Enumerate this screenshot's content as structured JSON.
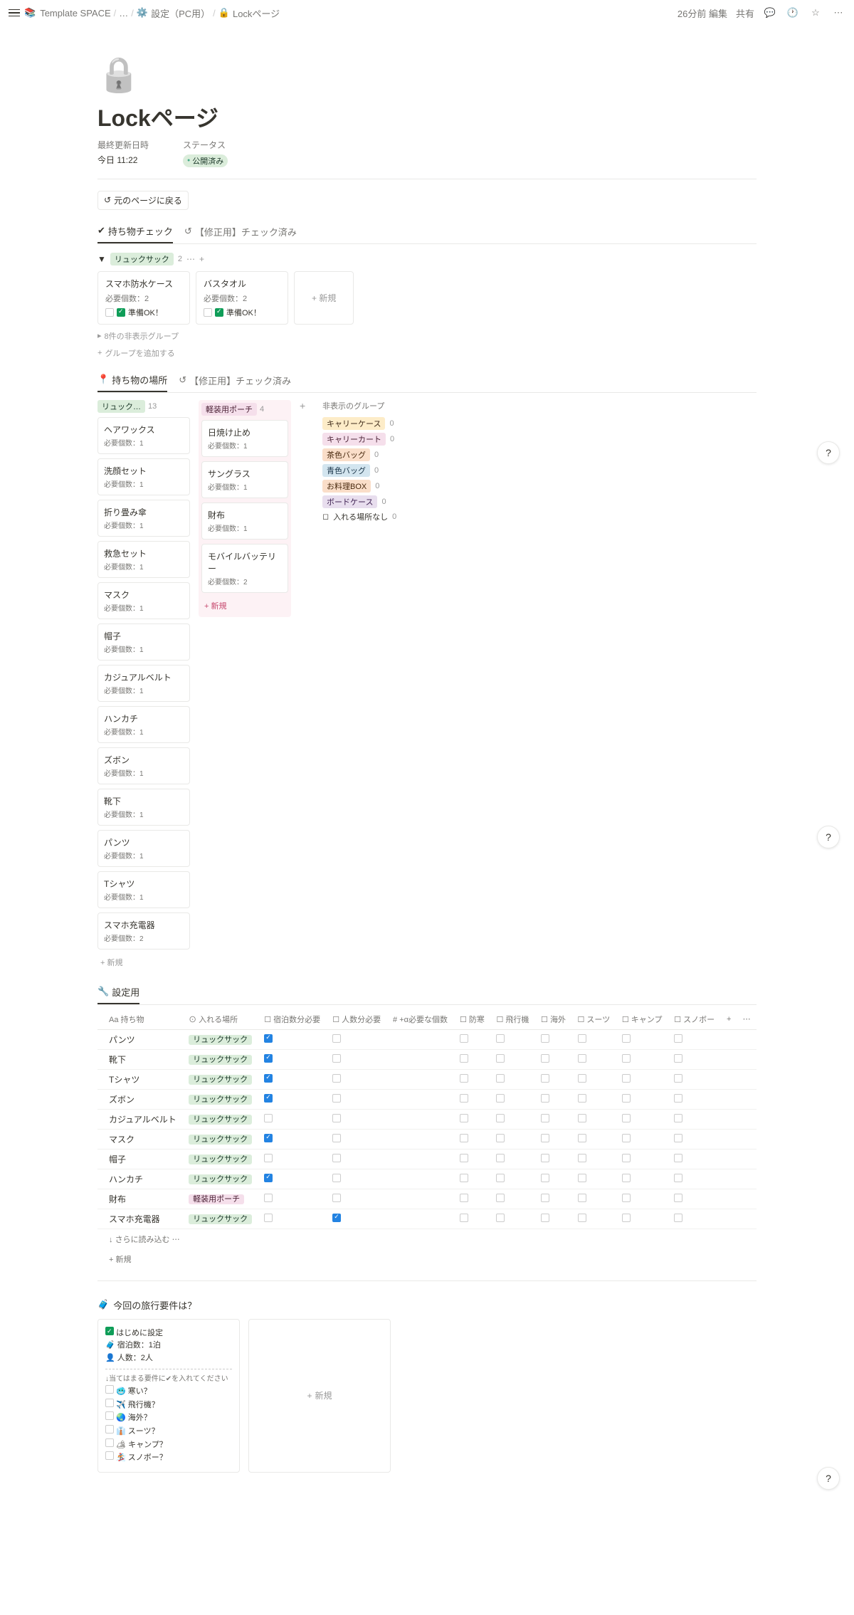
{
  "topbar": {
    "breadcrumb": [
      "Template SPACE",
      "…",
      "設定（PC用）",
      "Lockページ"
    ],
    "edited": "26分前 編集",
    "share": "共有"
  },
  "page": {
    "title": "Lockページ",
    "prop1_label": "最終更新日時",
    "prop2_label": "ステータス",
    "prop1_value": "今日 11:22",
    "prop2_value": "公開済み",
    "back_btn": "元のページに戻る"
  },
  "view1": {
    "tab1": "持ち物チェック",
    "tab2": "【修正用】チェック済み",
    "group_name": "リュックサック",
    "group_count": "2",
    "cards": [
      {
        "title": "スマホ防水ケース",
        "sub": "必要個数：2",
        "status": "準備OK！"
      },
      {
        "title": "バスタオル",
        "sub": "必要個数：2",
        "status": "準備OK！"
      }
    ],
    "new": "新規",
    "hidden": "8件の非表示グループ",
    "add_group": "グループを追加する"
  },
  "view2": {
    "tab1": "持ち物の場所",
    "tab2": "【修正用】チェック済み",
    "col1": {
      "name": "リュック…",
      "count": "13",
      "items": [
        {
          "t": "ヘアワックス",
          "s": "必要個数：1"
        },
        {
          "t": "洗顔セット",
          "s": "必要個数：1"
        },
        {
          "t": "折り畳み傘",
          "s": "必要個数：1"
        },
        {
          "t": "救急セット",
          "s": "必要個数：1"
        },
        {
          "t": "マスク",
          "s": "必要個数：1"
        },
        {
          "t": "帽子",
          "s": "必要個数：1"
        },
        {
          "t": "カジュアルベルト",
          "s": "必要個数：1"
        },
        {
          "t": "ハンカチ",
          "s": "必要個数：1"
        },
        {
          "t": "ズボン",
          "s": "必要個数：1"
        },
        {
          "t": "靴下",
          "s": "必要個数：1"
        },
        {
          "t": "パンツ",
          "s": "必要個数：1"
        },
        {
          "t": "Tシャツ",
          "s": "必要個数：1"
        },
        {
          "t": "スマホ充電器",
          "s": "必要個数：2"
        }
      ],
      "new": "新規"
    },
    "col2": {
      "name": "軽装用ポーチ",
      "count": "4",
      "items": [
        {
          "t": "日焼け止め",
          "s": "必要個数：1"
        },
        {
          "t": "サングラス",
          "s": "必要個数：1"
        },
        {
          "t": "財布",
          "s": "必要個数：1"
        },
        {
          "t": "モバイルバッテリー",
          "s": "必要個数：2"
        }
      ],
      "new": "新規"
    },
    "hidden_title": "非表示のグループ",
    "hidden": [
      {
        "t": "キャリーケース",
        "c": "0",
        "cls": "tag-yellow"
      },
      {
        "t": "キャリーカート",
        "c": "0",
        "cls": "tag-pink"
      },
      {
        "t": "茶色バッグ",
        "c": "0",
        "cls": "tag-orange"
      },
      {
        "t": "青色バッグ",
        "c": "0",
        "cls": "tag-blue"
      },
      {
        "t": "お料理BOX",
        "c": "0",
        "cls": "tag-orange"
      },
      {
        "t": "ボードケース",
        "c": "0",
        "cls": "tag-purple"
      }
    ],
    "hidden_last": {
      "t": "入れる場所なし",
      "c": "0"
    }
  },
  "table": {
    "tab": "設定用",
    "cols": [
      "持ち物",
      "入れる場所",
      "宿泊数分必要",
      "人数分必要",
      "+α必要な個数",
      "防寒",
      "飛行機",
      "海外",
      "スーツ",
      "キャンプ",
      "スノボー"
    ],
    "rows": [
      {
        "name": "パンツ",
        "loc": "リュックサック",
        "stay": true,
        "ppl": false
      },
      {
        "name": "靴下",
        "loc": "リュックサック",
        "stay": true,
        "ppl": false
      },
      {
        "name": "Tシャツ",
        "loc": "リュックサック",
        "stay": true,
        "ppl": false
      },
      {
        "name": "ズボン",
        "loc": "リュックサック",
        "stay": true,
        "ppl": false
      },
      {
        "name": "カジュアルベルト",
        "loc": "リュックサック",
        "stay": false,
        "ppl": false
      },
      {
        "name": "マスク",
        "loc": "リュックサック",
        "stay": true,
        "ppl": false
      },
      {
        "name": "帽子",
        "loc": "リュックサック",
        "stay": false,
        "ppl": false
      },
      {
        "name": "ハンカチ",
        "loc": "リュックサック",
        "stay": true,
        "ppl": false
      },
      {
        "name": "財布",
        "loc": "軽装用ポーチ",
        "stay": false,
        "ppl": false,
        "pink": true
      },
      {
        "name": "スマホ充電器",
        "loc": "リュックサック",
        "stay": false,
        "ppl": true
      }
    ],
    "load_more": "さらに読み込む",
    "new": "新規"
  },
  "req": {
    "title": "今回の旅行要件は？",
    "card": {
      "line1": "はじめに設定",
      "line2": "🧳 宿泊数：1泊",
      "line3": "👤 人数：2人",
      "hint": "↓当てはまる要件に✔を入れてください",
      "items": [
        "🥶 寒い？",
        "✈️ 飛行機？",
        "🌏 海外？",
        "👔 スーツ？",
        "🏕 キャンプ？",
        "🏂 スノボー？"
      ]
    },
    "new": "新規"
  }
}
